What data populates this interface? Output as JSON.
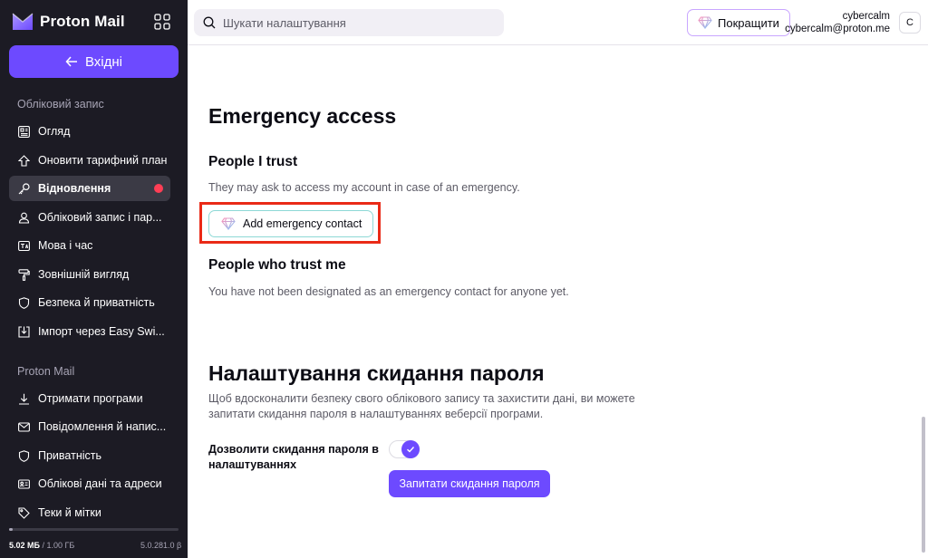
{
  "sidebar": {
    "brand": "Proton Mail",
    "back_label": "Вхідні",
    "section_account": "Обліковий запис",
    "account_items": [
      {
        "label": "Огляд",
        "icon": "dashboard-icon"
      },
      {
        "label": "Оновити тарифний план",
        "icon": "upgrade-icon"
      },
      {
        "label": "Відновлення",
        "icon": "key-icon",
        "active": true
      },
      {
        "label": "Обліковий запис і пар...",
        "icon": "user-icon"
      },
      {
        "label": "Мова і час",
        "icon": "language-icon"
      },
      {
        "label": "Зовнішній вигляд",
        "icon": "paint-roller-icon"
      },
      {
        "label": "Безпека й приватність",
        "icon": "shield-icon"
      },
      {
        "label": "Імпорт через Easy Swi...",
        "icon": "import-icon"
      }
    ],
    "section_mail": "Proton Mail",
    "mail_items": [
      {
        "label": "Отримати програми",
        "icon": "download-icon"
      },
      {
        "label": "Повідомлення й напис...",
        "icon": "envelope-icon"
      },
      {
        "label": "Приватність",
        "icon": "shield-icon"
      },
      {
        "label": "Облікові дані та адреси",
        "icon": "card-icon"
      },
      {
        "label": "Теки й мітки",
        "icon": "tag-icon"
      }
    ],
    "storage_used": "5.02 МБ",
    "storage_total": "/ 1.00 ГБ",
    "storage_fraction": 0.005,
    "version": "5.0.281.0 β"
  },
  "topbar": {
    "search_placeholder": "Шукати налаштування",
    "upgrade_label": "Покращити",
    "user_name": "cybercalm",
    "user_email": "cybercalm@proton.me",
    "avatar_initial": "C"
  },
  "main": {
    "emergency_title": "Emergency access",
    "trust_title": "People I trust",
    "trust_desc": "They may ask to access my account in case of an emergency.",
    "add_contact_label": "Add emergency contact",
    "trust_me_title": "People who trust me",
    "trust_me_desc": "You have not been designated as an emergency contact for anyone yet.",
    "reset_title": "Налаштування скидання пароля",
    "reset_desc_1": "Щоб вдосконалити безпеку свого облікового запису та захистити дані, ви можете",
    "reset_desc_2": "запитати скидання пароля в налаштуваннях веберсії програми.",
    "toggle_label_1": "Дозволити скидання пароля в",
    "toggle_label_2": "налаштуваннях",
    "toggle_on": true,
    "request_reset_label": "Запитати скидання пароля"
  },
  "colors": {
    "sidebar_bg": "#1c1b24",
    "accent": "#6d4aff",
    "highlight": "#ea2a17",
    "notification_dot": "#ff3e55"
  }
}
